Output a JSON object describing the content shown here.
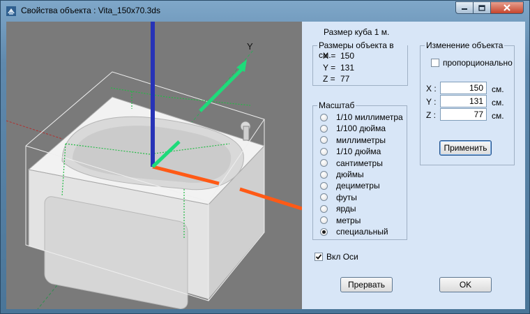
{
  "window": {
    "title": "Свойства объекта : Vita_150x70.3ds",
    "controls": {
      "minimize": "minimize-icon",
      "maximize": "maximize-icon",
      "close": "close-icon"
    }
  },
  "viewport": {
    "axis_label_y": "Y"
  },
  "panel": {
    "cube_size": "Размер куба 1 м.",
    "dimensions": {
      "title": "Размеры объекта в см.",
      "x_label": "X =",
      "x_value": "150",
      "y_label": "Y =",
      "y_value": "131",
      "z_label": "Z =",
      "z_value": "77"
    },
    "change": {
      "title": "Изменение объекта",
      "proportional_label": "пропорционально",
      "proportional_checked": false,
      "x_label": "X :",
      "x_value": "150",
      "x_unit": "см.",
      "y_label": "Y :",
      "y_value": "131",
      "y_unit": "см.",
      "z_label": "Z :",
      "z_value": "77",
      "z_unit": "см.",
      "apply_label": "Применить"
    },
    "scale": {
      "title": "Масштаб",
      "options": [
        "1/10 миллиметра",
        "1/100 дюйма",
        "миллиметры",
        "1/10 дюйма",
        "сантиметры",
        "дюймы",
        "дециметры",
        "футы",
        "ярды",
        "метры",
        "специальный"
      ],
      "selected_index": 10
    },
    "axes_toggle": {
      "label": "Вкл Оси",
      "checked": true
    },
    "cancel_label": "Прервать",
    "ok_label": "OK"
  }
}
